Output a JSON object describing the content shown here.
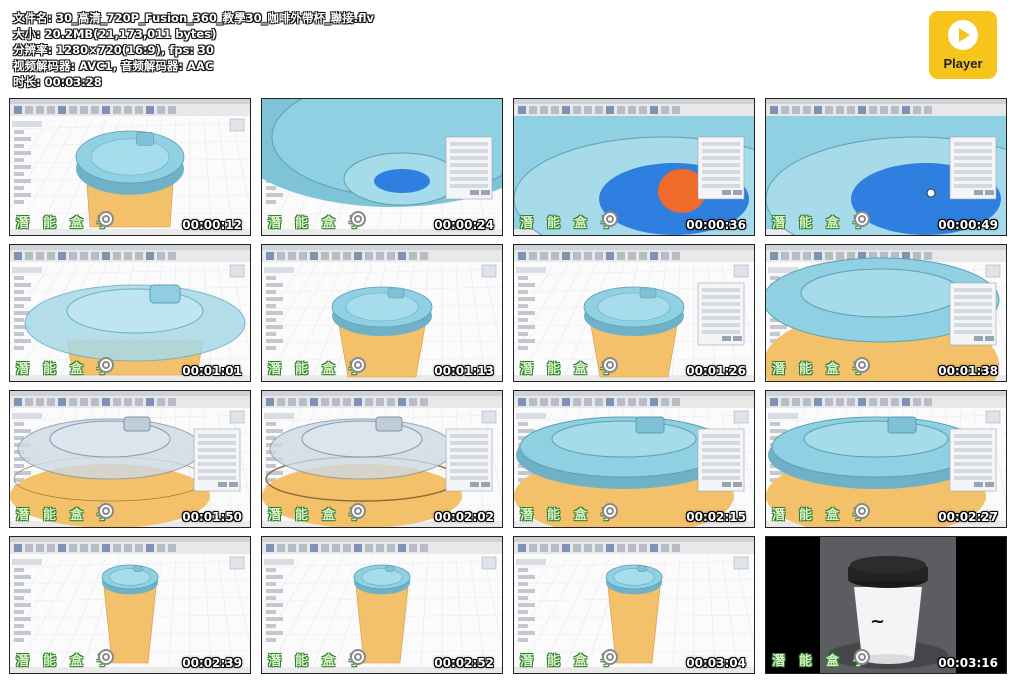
{
  "file_info": {
    "name_line": "文件名: 30_高清_720P_Fusion_360_教學30_咖啡外帶杯_聯接.flv",
    "size_line": "大小: 20.2MB(21,173,011 bytes)",
    "resolution_line": "分辨率: 1280×720(16:9), fps: 30",
    "codec_line": "视频解码器: AVC1, 音频解码器: AAC",
    "duration_line": "时长: 00:03:28"
  },
  "player_logo": {
    "label": "Player",
    "icon": "play-icon",
    "color": "#f6c41b"
  },
  "watermark": "潛能盒子",
  "thumbnails": [
    {
      "timestamp": "00:00:12",
      "scene": "lid-top"
    },
    {
      "timestamp": "00:00:24",
      "scene": "lid-closeup"
    },
    {
      "timestamp": "00:00:36",
      "scene": "lid-closeup-face"
    },
    {
      "timestamp": "00:00:49",
      "scene": "lid-closeup-blue"
    },
    {
      "timestamp": "00:01:01",
      "scene": "lid-wide"
    },
    {
      "timestamp": "00:01:13",
      "scene": "cup-lid"
    },
    {
      "timestamp": "00:01:26",
      "scene": "cup-lid-panel"
    },
    {
      "timestamp": "00:01:38",
      "scene": "lid-rim"
    },
    {
      "timestamp": "00:01:50",
      "scene": "lid-ghost"
    },
    {
      "timestamp": "00:02:02",
      "scene": "lid-ghost-select"
    },
    {
      "timestamp": "00:02:15",
      "scene": "lid-joined"
    },
    {
      "timestamp": "00:02:27",
      "scene": "lid-joined"
    },
    {
      "timestamp": "00:02:39",
      "scene": "cup-full"
    },
    {
      "timestamp": "00:02:52",
      "scene": "cup-full"
    },
    {
      "timestamp": "00:03:04",
      "scene": "cup-full"
    },
    {
      "timestamp": "00:03:16",
      "scene": "photo"
    }
  ],
  "colors": {
    "lid_blue": "#8fd0e2",
    "cup_yellow": "#f2c16a",
    "select_blue": "#2f7fe0",
    "select_orange": "#f06a2c",
    "toolbar_gray": "#e8e8e8"
  }
}
